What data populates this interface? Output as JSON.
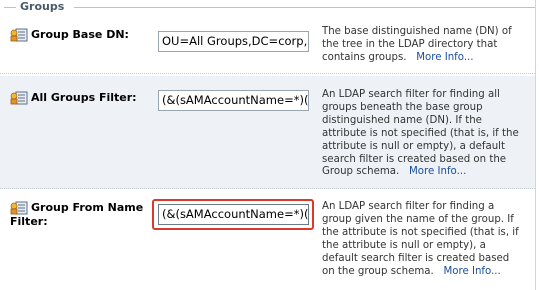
{
  "section": {
    "title": "Groups"
  },
  "rows": [
    {
      "label": "Group Base DN:",
      "value": "OU=All Groups,DC=corp,DC=example,DC=com",
      "description": "The base distinguished name (DN) of the tree in the LDAP directory that contains groups.",
      "more_info": "More Info..."
    },
    {
      "label": "All Groups Filter:",
      "value": "(&(sAMAccountName=*)(objectclass=group))",
      "description": "An LDAP search filter for finding all groups beneath the base group distinguished name (DN). If the attribute is not specified (that is, if the attribute is null or empty), a default search filter is created based on the Group schema.",
      "more_info": "More Info..."
    },
    {
      "label_line1": "Group From Name",
      "label_line2": "Filter:",
      "value": "(&(sAMAccountName=*)(objectclass=group))",
      "description": "An LDAP search filter for finding a group given the name of the group. If the attribute is not specified (that is, if the attribute is null or empty), a default search filter is created based on the group schema.",
      "more_info": "More Info..."
    }
  ],
  "icons": {
    "field_icon": "ldap-attribute-icon"
  }
}
